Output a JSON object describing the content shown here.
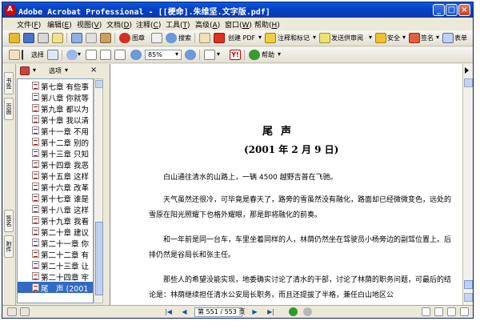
{
  "window": {
    "title": "Adobe Acrobat Professional - [[梗命].朱维坚.文字版.pdf]",
    "app_icon": "A",
    "min_label": "_",
    "max_label": "□",
    "close_label": "×"
  },
  "menu": [
    {
      "label": "文件(",
      "key": "F",
      "end": ")"
    },
    {
      "label": "编辑(",
      "key": "E",
      "end": ")"
    },
    {
      "label": "视图(",
      "key": "V",
      "end": ")"
    },
    {
      "label": "文档(",
      "key": "D",
      "end": ")"
    },
    {
      "label": "注释(",
      "key": "C",
      "end": ")"
    },
    {
      "label": "工具(",
      "key": "T",
      "end": ")"
    },
    {
      "label": "高级(",
      "key": "A",
      "end": ")"
    },
    {
      "label": "窗口(",
      "key": "W",
      "end": ")"
    },
    {
      "label": "帮助(",
      "key": "H",
      "end": ")"
    }
  ],
  "toolbar": {
    "image_label": "图章",
    "search_label": "搜索",
    "create_pdf_label": "创建 PDF",
    "comment_label": "注释和标记",
    "review_label": "发送供审阅",
    "security_label": "安全",
    "sign_label": "签名",
    "form_label": "表单",
    "select_label": "选择",
    "zoom_value": "85%",
    "help_label": "帮助",
    "chevron": "▾"
  },
  "panel": {
    "options_label": "选项",
    "close_label": "×",
    "tabs": [
      "书签",
      "页面",
      "签名",
      "附件"
    ],
    "bookmarks": [
      "第七章 有些事",
      "第八章 你就等",
      "第九章 都以为",
      "第十章 我以清",
      "第十一章 不用",
      "第十二章 别的",
      "第十三章 只知",
      "第十四章 我恶",
      "第十五章 这样",
      "第十六章 改革",
      "第十七章 谁是",
      "第十八章 这样",
      "第十九章 我看",
      "第二十章 建议",
      "第二十一章 你",
      "第二十二章 有",
      "第二十三章 让",
      "第二十四章 牢",
      "尾　声 (2001"
    ],
    "selected_index": 18
  },
  "document": {
    "heading": "尾声",
    "date": "(2001 年 2 月 9 日)",
    "paragraphs": [
      "白山通往清水的山路上，一辆 4500 越野吉普在飞驰。",
      "天气虽然还很冷，可毕竟是春天了，路旁的雪虽然没有融化，路面却已经微微变色，远处的雪原在阳光照耀下也格外耀眼，那是即将融化的前奏。",
      "和一年前是同一台车，车里坐着同样的人，林荫仍然坐在驾驶员小杨旁边的副驾位置上。后排仍然是谷局长和张主任。",
      "那些人的希望没能实现，地委确实讨论了清水的干部，讨论了林荫的职务问题，可最后的结论是：林荫继续担任清水公安局长职务，而且还提拔了半格，兼任白山地区公"
    ]
  },
  "status": {
    "page_display": "第 551 / 553 页",
    "first": "|◀",
    "prev": "◀",
    "next": "▶",
    "last": "▶|"
  }
}
